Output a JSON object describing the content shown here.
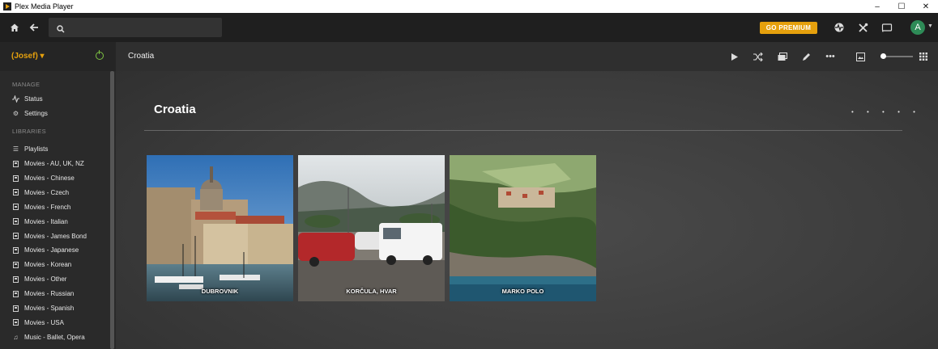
{
  "window": {
    "title": "Plex Media Player",
    "minimize": "–",
    "maximize": "☐",
    "close": "✕"
  },
  "topbar": {
    "premium_label": "GO PREMIUM",
    "avatar_letter": "A"
  },
  "sidebar": {
    "user": "(Josef) ▾",
    "manage_header": "MANAGE",
    "manage": [
      {
        "label": "Status",
        "icon": "activity-icon"
      },
      {
        "label": "Settings",
        "icon": "gear-icon"
      }
    ],
    "libraries_header": "LIBRARIES",
    "libraries": [
      {
        "label": "Playlists",
        "icon": "list-icon"
      },
      {
        "label": "Movies - AU, UK, NZ",
        "icon": "film-icon"
      },
      {
        "label": "Movies - Chinese",
        "icon": "film-icon"
      },
      {
        "label": "Movies - Czech",
        "icon": "film-icon"
      },
      {
        "label": "Movies - French",
        "icon": "film-icon"
      },
      {
        "label": "Movies - Italian",
        "icon": "film-icon"
      },
      {
        "label": "Movies - James Bond",
        "icon": "film-icon"
      },
      {
        "label": "Movies - Japanese",
        "icon": "film-icon"
      },
      {
        "label": "Movies - Korean",
        "icon": "film-icon"
      },
      {
        "label": "Movies - Other",
        "icon": "film-icon"
      },
      {
        "label": "Movies - Russian",
        "icon": "film-icon"
      },
      {
        "label": "Movies - Spanish",
        "icon": "film-icon"
      },
      {
        "label": "Movies - USA",
        "icon": "film-icon"
      },
      {
        "label": "Music - Ballet, Opera",
        "icon": "music-icon"
      }
    ]
  },
  "header": {
    "breadcrumb": "Croatia"
  },
  "page": {
    "title": "Croatia",
    "dots": "• • • • •"
  },
  "albums": [
    {
      "label": "DUBROVNIK"
    },
    {
      "label": "KORČULA, HVAR"
    },
    {
      "label": "MARKO POLO"
    }
  ],
  "colors": {
    "accent": "#e5a00d",
    "power": "#7cc142",
    "avatar": "#2e8b57"
  }
}
